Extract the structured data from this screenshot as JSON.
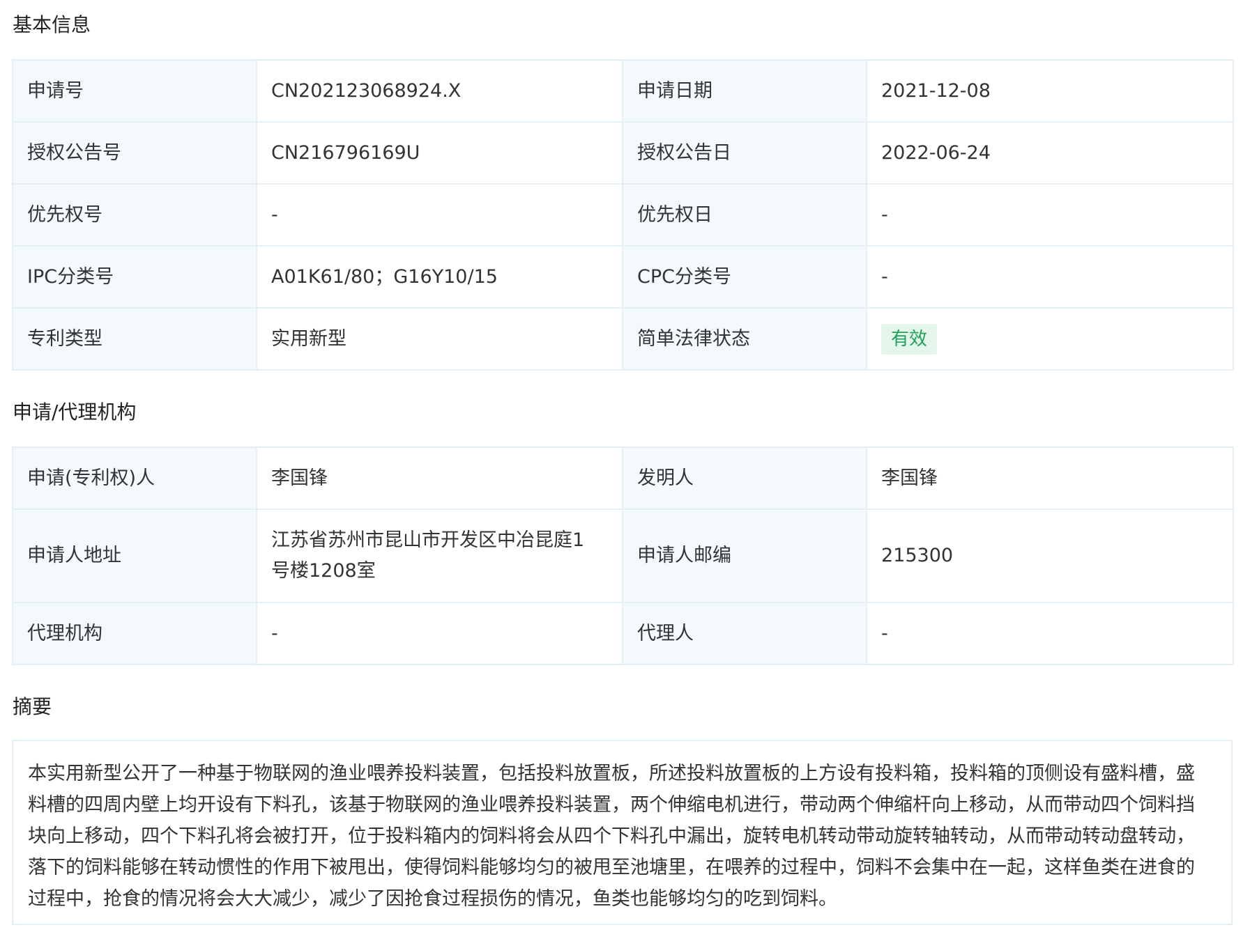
{
  "sections": {
    "basic_title": "基本信息",
    "agency_title": "申请/代理机构",
    "abstract_title": "摘要"
  },
  "basic_info": {
    "rows": [
      {
        "label1": "申请号",
        "value1": "CN202123068924.X",
        "label2": "申请日期",
        "value2": "2021-12-08"
      },
      {
        "label1": "授权公告号",
        "value1": "CN216796169U",
        "label2": "授权公告日",
        "value2": "2022-06-24"
      },
      {
        "label1": "优先权号",
        "value1": "-",
        "label2": "优先权日",
        "value2": "-"
      },
      {
        "label1": "IPC分类号",
        "value1": "A01K61/80；G16Y10/15",
        "label2": "CPC分类号",
        "value2": "-"
      },
      {
        "label1": "专利类型",
        "value1": "实用新型",
        "label2": "简单法律状态",
        "value2": "有效"
      }
    ],
    "status_badge_color": "#20a15a",
    "status_badge_bg": "#e4f6ea"
  },
  "agency_info": {
    "rows": [
      {
        "label1": "申请(专利权)人",
        "value1": "李国锋",
        "label2": "发明人",
        "value2": "李国锋"
      },
      {
        "label1": "申请人地址",
        "value1": "江苏省苏州市昆山市开发区中冶昆庭1号楼1208室",
        "label2": "申请人邮编",
        "value2": "215300"
      },
      {
        "label1": "代理机构",
        "value1": "-",
        "label2": "代理人",
        "value2": "-"
      }
    ]
  },
  "abstract": {
    "text": "本实用新型公开了一种基于物联网的渔业喂养投料装置，包括投料放置板，所述投料放置板的上方设有投料箱，投料箱的顶侧设有盛料槽，盛料槽的四周内壁上均开设有下料孔，该基于物联网的渔业喂养投料装置，两个伸缩电机进行，带动两个伸缩杆向上移动，从而带动四个饲料挡块向上移动，四个下料孔将会被打开，位于投料箱内的饲料将会从四个下料孔中漏出，旋转电机转动带动旋转轴转动，从而带动转动盘转动，落下的饲料能够在转动惯性的作用下被甩出，使得饲料能够均匀的被甩至池塘里，在喂养的过程中，饲料不会集中在一起，这样鱼类在进食的过程中，抢食的情况将会大大减少，减少了因抢食过程损伤的情况，鱼类也能够均匀的吃到饲料。"
  },
  "colors": {
    "label_bg": "#f3f9fc",
    "border": "#e3eef5",
    "text": "#333333"
  }
}
